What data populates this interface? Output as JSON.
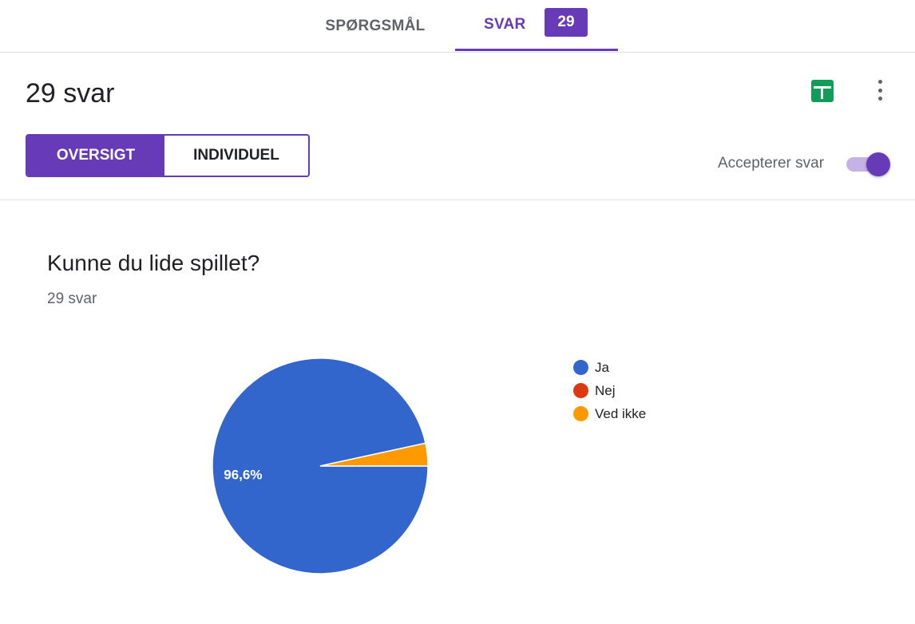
{
  "tabs": {
    "questions_label": "SPØRGSMÅL",
    "responses_label": "SVAR",
    "responses_count": "29"
  },
  "header": {
    "title": "29 svar",
    "sheets_icon": "sheets-icon",
    "more_icon": "more-vert-icon"
  },
  "view_toggle": {
    "overview_label": "OVERSIGT",
    "individual_label": "INDIVIDUEL"
  },
  "accepting": {
    "label": "Accepterer svar",
    "enabled": true
  },
  "question": {
    "title": "Kunne du lide spillet?",
    "count_text": "29 svar"
  },
  "colors": {
    "accent": "#673ab7",
    "sheets": "#0f9d58"
  },
  "chart_data": {
    "type": "pie",
    "categories": [
      "Ja",
      "Nej",
      "Ved ikke"
    ],
    "values": [
      96.6,
      0,
      3.4
    ],
    "colors": [
      "#3366cc",
      "#dc3912",
      "#ff9900"
    ],
    "data_labels": [
      "96,6%",
      "",
      ""
    ],
    "legend_placement": "right"
  }
}
